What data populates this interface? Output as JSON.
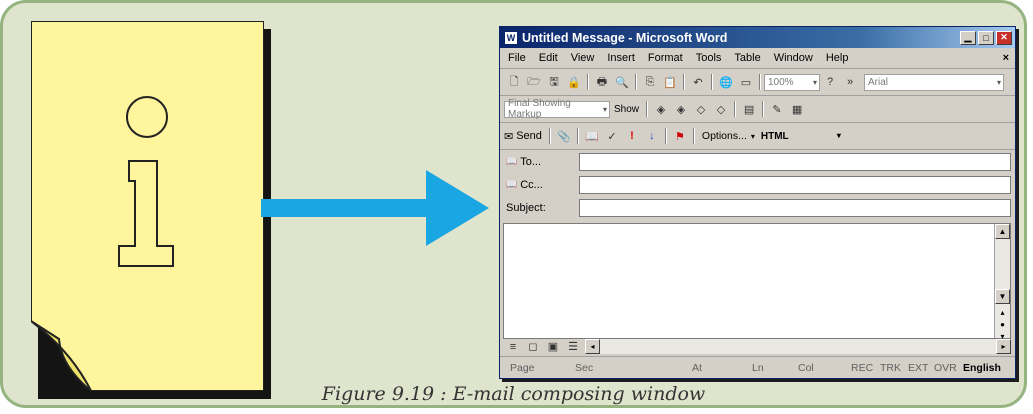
{
  "caption": "Figure 9.19 : E-mail composing window",
  "colors": {
    "frame_bg": "#dfe4cd",
    "frame_border": "#94b37f",
    "note": "#fff59d",
    "arrow": "#1aa6e2",
    "titlebar": "#0a246a"
  },
  "window": {
    "title": "Untitled Message - Microsoft Word",
    "menu": [
      "File",
      "Edit",
      "View",
      "Insert",
      "Format",
      "Tools",
      "Table",
      "Window",
      "Help"
    ],
    "standard_toolbar": {
      "zoom": "100%",
      "font": "Arial"
    },
    "reviewing_toolbar": {
      "markup_mode": "Final Showing Markup",
      "show_label": "Show"
    },
    "email_toolbar": {
      "send_label": "Send",
      "options_label": "Options...",
      "format": "HTML"
    },
    "fields": [
      {
        "label": "To...",
        "value": ""
      },
      {
        "label": "Cc...",
        "value": ""
      },
      {
        "label": "Subject:",
        "value": ""
      }
    ],
    "status_bar": [
      "Page",
      "Sec",
      "At",
      "Ln",
      "Col",
      "REC",
      "TRK",
      "EXT",
      "OVR",
      "English"
    ]
  }
}
